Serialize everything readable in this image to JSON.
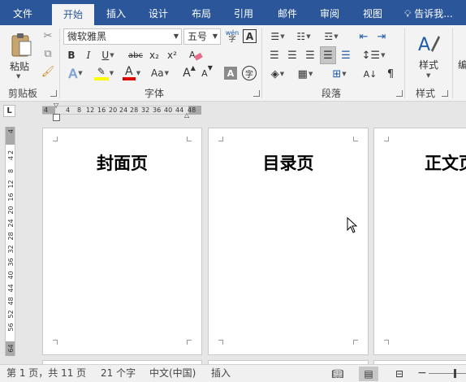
{
  "tabs": {
    "file": "文件",
    "home": "开始",
    "insert": "插入",
    "design": "设计",
    "layout": "布局",
    "references": "引用",
    "mailings": "邮件",
    "review": "审阅",
    "view": "视图",
    "tell_me": "告诉我..."
  },
  "ribbon": {
    "clipboard": {
      "paste_label": "粘贴",
      "group_label": "剪贴板"
    },
    "font": {
      "font_name": "微软雅黑",
      "font_size": "五号",
      "bold": "B",
      "italic": "I",
      "underline": "U",
      "strikethrough": "abc",
      "subscript": "x₂",
      "superscript": "x²",
      "change_case": "Aa",
      "grow": "A",
      "shrink": "A",
      "char_border": "A",
      "char_shading": "A",
      "enclose": "字",
      "phonetic": "wén",
      "group_label": "字体"
    },
    "paragraph": {
      "group_label": "段落"
    },
    "styles": {
      "styles_label": "样式",
      "group_label": "样式",
      "edit_label": "编"
    }
  },
  "ruler": {
    "ticks": [
      "4",
      "4",
      "8",
      "12",
      "16",
      "20",
      "24",
      "28",
      "32",
      "36",
      "40",
      "44",
      "48"
    ],
    "corner": "L",
    "vertical_ticks": [
      "4",
      "2",
      "4",
      "8",
      "12",
      "16",
      "20",
      "24",
      "28",
      "32",
      "36",
      "40",
      "44",
      "48",
      "52",
      "56",
      "64"
    ]
  },
  "pages": [
    {
      "title": "封面页"
    },
    {
      "title": "目录页"
    },
    {
      "title": "正文页"
    }
  ],
  "status": {
    "page": "第 1 页，共 11 页",
    "words": "21 个字",
    "language": "中文(中国)",
    "mode": "插入"
  },
  "colors": {
    "tab_bar": "#2b579a",
    "ribbon": "#f3f3f3",
    "highlight_yellow": "#ffff00",
    "font_red": "#e00000"
  }
}
